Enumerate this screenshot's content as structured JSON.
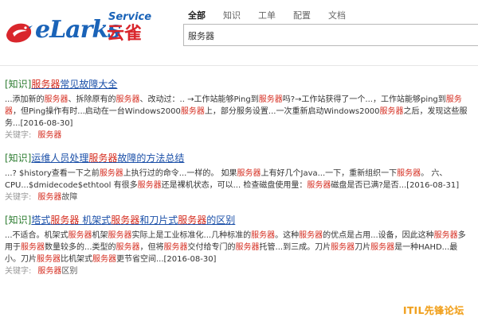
{
  "brand": {
    "logo_main": "eLarks",
    "logo_cn": "云雀",
    "logo_service": "Service",
    "color_blue": "#1a63b8",
    "color_red": "#d9262c"
  },
  "tabs": [
    {
      "label": "全部",
      "active": true
    },
    {
      "label": "知识",
      "active": false
    },
    {
      "label": "工单",
      "active": false
    },
    {
      "label": "配置",
      "active": false
    },
    {
      "label": "文档",
      "active": false
    }
  ],
  "search": {
    "value": "服务器"
  },
  "results": [
    {
      "tag": "[知识]",
      "title": [
        {
          "t": "服务器",
          "hl": true
        },
        {
          "t": "常见故障大全",
          "hl": false
        }
      ],
      "snippet": [
        {
          "t": "...添加新的",
          "hl": false
        },
        {
          "t": "服务器",
          "hl": true
        },
        {
          "t": "、拆除原有的",
          "hl": false
        },
        {
          "t": "服务器",
          "hl": true
        },
        {
          "t": "、改动过：.. →工作站能够Ping到",
          "hl": false
        },
        {
          "t": "服务器",
          "hl": true
        },
        {
          "t": "吗?→工作站获得了一个...，工作站能够ping到",
          "hl": false
        },
        {
          "t": "服务器",
          "hl": true
        },
        {
          "t": "，但Ping操作有时...启动在一台Windows2000",
          "hl": false
        },
        {
          "t": "服务器",
          "hl": true
        },
        {
          "t": "上，部分服务设置...一次重新启动Windows2000",
          "hl": false
        },
        {
          "t": "服务器",
          "hl": true
        },
        {
          "t": "之后，发现这些服务...[2016-08-30]",
          "hl": false
        }
      ],
      "keyword_label": "关键字:",
      "keywords": [
        {
          "t": "服务器",
          "hl": true
        }
      ]
    },
    {
      "tag": "[知识]",
      "title": [
        {
          "t": "运维人员处理",
          "hl": false
        },
        {
          "t": "服务器",
          "hl": true
        },
        {
          "t": "故障的方法总结",
          "hl": false
        }
      ],
      "snippet": [
        {
          "t": "...? $history查看一下之前",
          "hl": false
        },
        {
          "t": "服务器",
          "hl": true
        },
        {
          "t": "上执行过的命令...一样的。 如果",
          "hl": false
        },
        {
          "t": "服务器",
          "hl": true
        },
        {
          "t": "上有好几个Java...一下，重新组织一下",
          "hl": false
        },
        {
          "t": "服务器",
          "hl": true
        },
        {
          "t": "。 六、CPU...$dmidecode$ethtool 有很多",
          "hl": false
        },
        {
          "t": "服务器",
          "hl": true
        },
        {
          "t": "还是裸机状态，可以... 检查磁盘使用量：",
          "hl": false
        },
        {
          "t": "服务器",
          "hl": true
        },
        {
          "t": "磁盘是否已满?是否...[2016-08-31]",
          "hl": false
        }
      ],
      "keyword_label": "关键字:",
      "keywords": [
        {
          "t": "服务器",
          "hl": true
        },
        {
          "t": "故障",
          "hl": false
        }
      ]
    },
    {
      "tag": "[知识]",
      "title": [
        {
          "t": "塔式",
          "hl": false
        },
        {
          "t": "服务器",
          "hl": true
        },
        {
          "t": " 机架式",
          "hl": false
        },
        {
          "t": "服务器",
          "hl": true
        },
        {
          "t": "和刀片式",
          "hl": false
        },
        {
          "t": "服务器",
          "hl": true
        },
        {
          "t": "的区别",
          "hl": false
        }
      ],
      "snippet": [
        {
          "t": "...不适合。机架式",
          "hl": false
        },
        {
          "t": "服务器",
          "hl": true
        },
        {
          "t": "机架",
          "hl": false
        },
        {
          "t": "服务器",
          "hl": true
        },
        {
          "t": "实际上是工业标准化...几种标准的",
          "hl": false
        },
        {
          "t": "服务器",
          "hl": true
        },
        {
          "t": "。这种",
          "hl": false
        },
        {
          "t": "服务器",
          "hl": true
        },
        {
          "t": "的优点是占用...设备，因此这种",
          "hl": false
        },
        {
          "t": "服务器",
          "hl": true
        },
        {
          "t": "多用于",
          "hl": false
        },
        {
          "t": "服务器",
          "hl": true
        },
        {
          "t": "数量较多的...类型的",
          "hl": false
        },
        {
          "t": "服务器",
          "hl": true
        },
        {
          "t": "，但将",
          "hl": false
        },
        {
          "t": "服务器",
          "hl": true
        },
        {
          "t": "交付给专门的",
          "hl": false
        },
        {
          "t": "服务器",
          "hl": true
        },
        {
          "t": "托管...到三成。刀片",
          "hl": false
        },
        {
          "t": "服务器",
          "hl": true
        },
        {
          "t": "刀片",
          "hl": false
        },
        {
          "t": "服务器",
          "hl": true
        },
        {
          "t": "是一种HAHD...最小。刀片",
          "hl": false
        },
        {
          "t": "服务器",
          "hl": true
        },
        {
          "t": "比机架式",
          "hl": false
        },
        {
          "t": "服务器",
          "hl": true
        },
        {
          "t": "更节省空间...[2016-08-30]",
          "hl": false
        }
      ],
      "keyword_label": "关键字:",
      "keywords": [
        {
          "t": "服务器",
          "hl": true
        },
        {
          "t": "区别",
          "hl": false
        }
      ]
    }
  ],
  "watermark": "ITIL先锋论坛"
}
